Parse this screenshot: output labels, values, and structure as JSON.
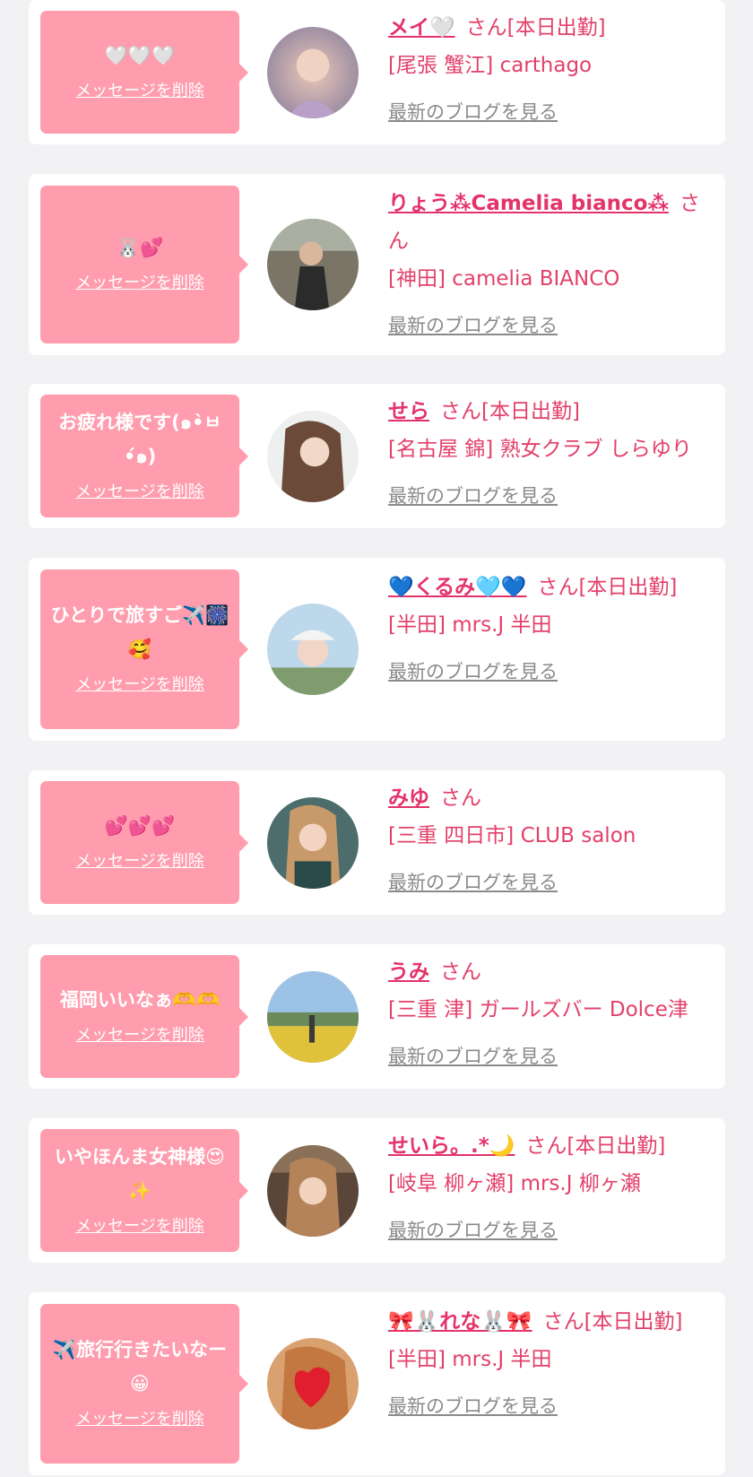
{
  "delete_label": "メッセージを削除",
  "blog_label": "最新のブログを見る",
  "colors": {
    "background": "#f2f2f4",
    "card": "#ffffff",
    "bubble": "#ff9cad",
    "accent_pink": "#e3336a",
    "link_gray": "#8a8a8a"
  },
  "entries": [
    {
      "message": "🤍🤍🤍",
      "name": "メイ🤍",
      "suffix": "さん[本日出勤]",
      "shop": "[尾張 蟹江] carthago",
      "avatar_icon": "profile-photo"
    },
    {
      "message": "🐰💕",
      "name": "りょう⁂Camelia bianco⁂",
      "suffix": "さん",
      "shop": "[神田] camelia BIANCO",
      "avatar_icon": "profile-photo"
    },
    {
      "message": "お疲れ様です(๑•̀ㅂ•́๑)",
      "name": "せら",
      "suffix": "さん[本日出勤]",
      "shop": "[名古屋 錦] 熟女クラブ しらゆり",
      "avatar_icon": "profile-photo"
    },
    {
      "message": "ひとりで旅すご✈️🎆🥰",
      "name": "💙くるみ🩵💙",
      "suffix": "さん[本日出勤]",
      "shop": "[半田] mrs.J 半田",
      "avatar_icon": "profile-photo"
    },
    {
      "message": "💕💕💕",
      "name": "みゆ",
      "suffix": "さん",
      "shop": "[三重 四日市] CLUB salon",
      "avatar_icon": "profile-photo"
    },
    {
      "message": "福岡いいなぁ🫶🫶",
      "name": "うみ",
      "suffix": "さん",
      "shop": "[三重 津] ガールズバー Dolce津",
      "avatar_icon": "profile-photo"
    },
    {
      "message": "いやほんま女神様😍✨",
      "name": "せいら。.*🌙",
      "suffix": "さん[本日出勤]",
      "shop": "[岐阜 柳ヶ瀬] mrs.J 柳ヶ瀬",
      "avatar_icon": "profile-photo"
    },
    {
      "message": "✈️旅行行きたいなー😀",
      "name": "🎀🐰れな🐰🎀",
      "suffix": "さん[本日出勤]",
      "shop": "[半田] mrs.J 半田",
      "avatar_icon": "profile-photo"
    }
  ]
}
